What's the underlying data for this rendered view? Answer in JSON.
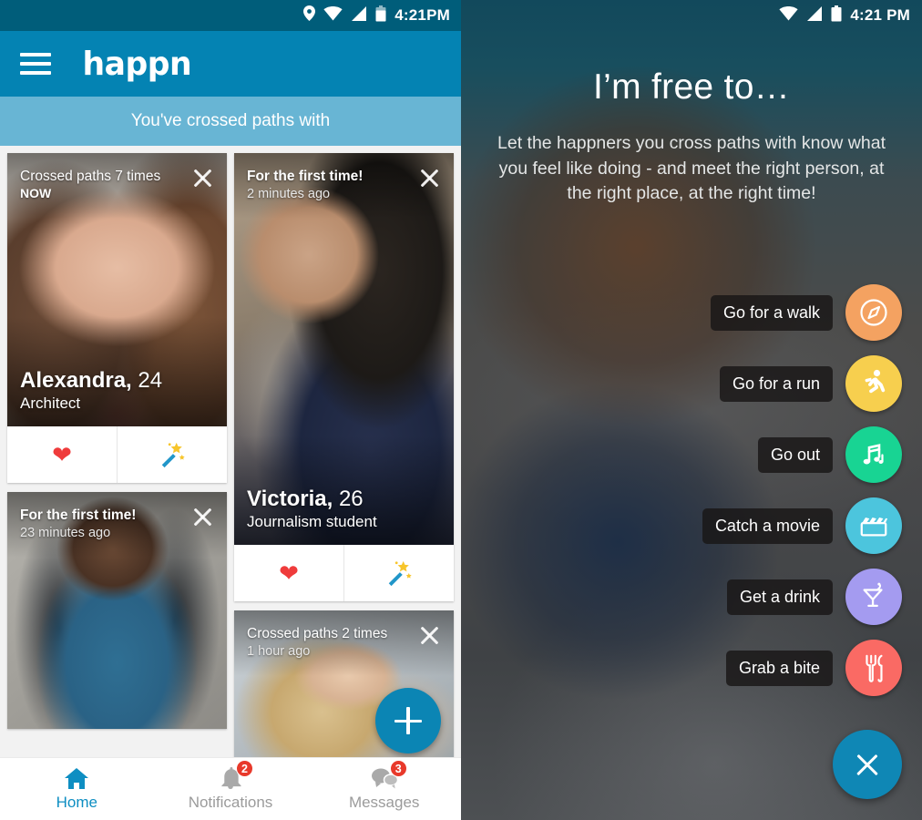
{
  "left": {
    "status_bar": {
      "time": "4:21PM",
      "icons": [
        "location-icon",
        "wifi-icon",
        "signal-icon",
        "battery-icon"
      ]
    },
    "app_bar": {
      "menu_icon": "hamburger-icon",
      "logo": "happn"
    },
    "sub_bar": {
      "text": "You've crossed paths with"
    },
    "cards": [
      {
        "meta_top": "Crossed paths 7 times",
        "meta_sub": "NOW",
        "meta_sub_bold": true,
        "name": "Alexandra, ",
        "age": "24",
        "job": "Architect",
        "like_icon": "heart-icon",
        "charm_icon": "magic-wand-icon",
        "has_actions": true
      },
      {
        "meta_top": "For the first time!",
        "meta_sub": "2 minutes ago",
        "meta_sub_bold": false,
        "name": "Victoria, ",
        "age": "26",
        "job": "Journalism student",
        "like_icon": "heart-icon",
        "charm_icon": "magic-wand-icon",
        "has_actions": true
      },
      {
        "meta_top": "For the first time!",
        "meta_sub": "23 minutes ago",
        "meta_sub_bold": false,
        "name": "",
        "age": "",
        "job": "",
        "has_actions": false
      },
      {
        "meta_top": "Crossed paths 2 times",
        "meta_sub": "1 hour ago",
        "meta_sub_bold": false,
        "name": "",
        "age": "",
        "job": "",
        "has_actions": false
      }
    ],
    "fab": {
      "icon": "plus-icon"
    },
    "bottom_nav": [
      {
        "label": "Home",
        "icon": "home-icon",
        "badge": "",
        "active": true
      },
      {
        "label": "Notifications",
        "icon": "bell-icon",
        "badge": "2",
        "active": false
      },
      {
        "label": "Messages",
        "icon": "chat-icon",
        "badge": "3",
        "active": false
      }
    ]
  },
  "right": {
    "status_bar": {
      "time": "4:21 PM",
      "icons": [
        "wifi-icon",
        "signal-icon",
        "battery-icon"
      ]
    },
    "title": "I’m free to…",
    "description": "Let the happners you cross paths with know what you feel like doing - and meet the right person, at the right place, at the right time!",
    "actions": [
      {
        "label": "Go for a walk",
        "icon": "compass-icon",
        "color": "#f4a261"
      },
      {
        "label": "Go for a run",
        "icon": "runner-icon",
        "color": "#f7cf4e"
      },
      {
        "label": "Go out",
        "icon": "music-icon",
        "color": "#18d493"
      },
      {
        "label": "Catch a movie",
        "icon": "clapboard-icon",
        "color": "#4cc5dd"
      },
      {
        "label": "Get a drink",
        "icon": "cocktail-icon",
        "color": "#a49bf0"
      },
      {
        "label": "Grab a bite",
        "icon": "cutlery-icon",
        "color": "#fa6a64"
      }
    ],
    "close_button": {
      "icon": "close-icon"
    }
  },
  "colors": {
    "status_bar": "#005d7a",
    "app_bar": "#0483b3",
    "sub_bar": "#68b5d4",
    "accent": "#0e8ec2",
    "fab": "#0b85b4",
    "badge": "#e8392b",
    "heart": "#ef3b3b"
  }
}
